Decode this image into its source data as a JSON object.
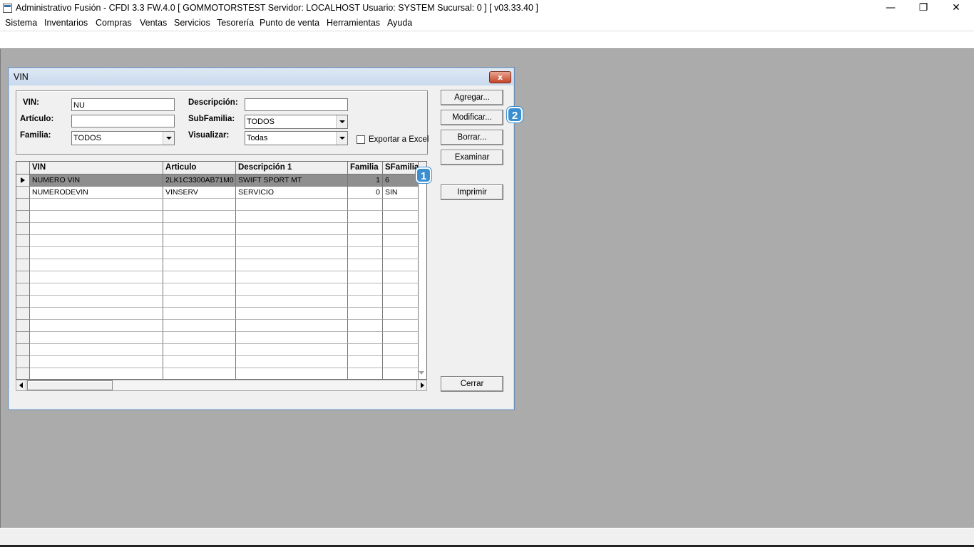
{
  "window": {
    "title": "Administrativo Fusión - CFDI 3.3 FW.4.0 [ GOMMOTORSTEST  Servidor: LOCALHOST  Usuario: SYSTEM    Sucursal: 0 ] [ v03.33.40 ]",
    "icons": {
      "app": "app-window-icon",
      "minimize": "minimize-icon",
      "maximize": "restore-icon",
      "close": "close-icon"
    },
    "minimize_glyph": "—",
    "restore_glyph": "❐",
    "close_glyph": "✕"
  },
  "menu": [
    "Sistema",
    "Inventarios",
    "Compras",
    "Ventas",
    "Servicios",
    "Tesorería",
    "Punto de venta",
    "Herramientas",
    "Ayuda"
  ],
  "dialog": {
    "title": "VIN",
    "close_glyph": "x",
    "filters": {
      "vin_label": "VIN:",
      "vin_value": "NU",
      "descripcion_label": "Descripción:",
      "descripcion_value": "",
      "articulo_label": "Artículo:",
      "articulo_value": "",
      "subfamilia_label": "SubFamilia:",
      "subfamilia_value": "TODOS",
      "familia_label": "Familia:",
      "familia_value": "TODOS",
      "visualizar_label": "Visualizar:",
      "visualizar_value": "Todas",
      "exportar_label": "Exportar a Excel"
    },
    "buttons": {
      "agregar": "Agregar...",
      "modificar": "Modificar...",
      "borrar": "Borrar...",
      "examinar": "Examinar",
      "imprimir": "Imprimir",
      "cerrar": "Cerrar"
    },
    "grid": {
      "columns": [
        "VIN",
        "Articulo",
        "Descripción 1",
        "Familia",
        "SFamilia"
      ],
      "rows": [
        [
          "NUMERO VIN",
          "2LK1C3300AB71M0",
          "SWIFT SPORT MT",
          "1",
          "6"
        ],
        [
          "NUMERODEVIN",
          "VINSERV",
          "SERVICIO",
          "0",
          "SIN"
        ]
      ],
      "selected_row": 0,
      "empty_rows": 15
    },
    "markers": [
      "1",
      "2"
    ],
    "marker_color": "#3b8fd1"
  }
}
